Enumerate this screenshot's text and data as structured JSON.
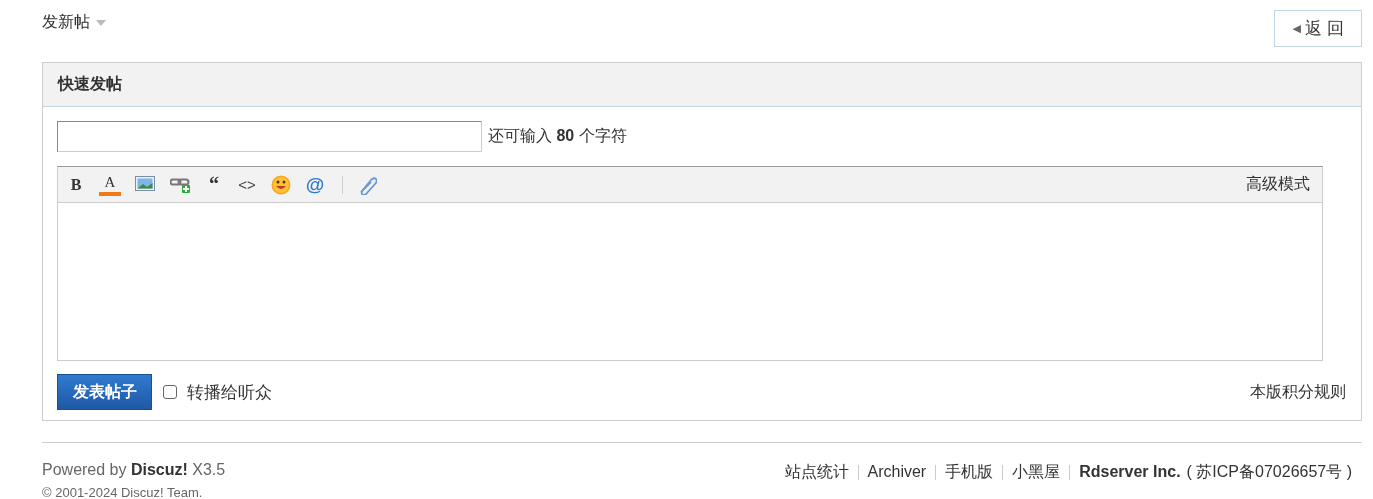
{
  "top_bar": {
    "new_post": "发新帖",
    "back_button": {
      "arrow": "◀",
      "label": "返 回"
    }
  },
  "quick_post": {
    "title": "快速发帖",
    "subject": {
      "hint_parts": [
        "还可输入 ",
        "80",
        " 个字符"
      ]
    },
    "toolbar": [
      {
        "kind": "bold",
        "label": "B"
      },
      {
        "kind": "color",
        "label": "A"
      },
      {
        "kind": "image"
      },
      {
        "kind": "link"
      },
      {
        "kind": "quote",
        "label": "“"
      },
      {
        "kind": "code",
        "label": "<>"
      },
      {
        "kind": "smiley"
      },
      {
        "kind": "at",
        "label": "@"
      },
      {
        "kind": "attach"
      }
    ],
    "advanced_mode": "高级模式",
    "submit": "发表帖子",
    "broadcast": {
      "label": "转播给听众",
      "checked": false
    },
    "credit_rules": "本版积分规则"
  },
  "footer": {
    "powered_prefix": "Powered by ",
    "powered_brand": "Discuz!",
    "powered_version": " X3.5",
    "copyright": "© 2001-2024 Discuz! Team.",
    "links": [
      "站点统计",
      "Archiver",
      "手机版",
      "小黑屋"
    ],
    "company": "Rdserver Inc.",
    "icp": "( 苏ICP备07026657号 )"
  }
}
